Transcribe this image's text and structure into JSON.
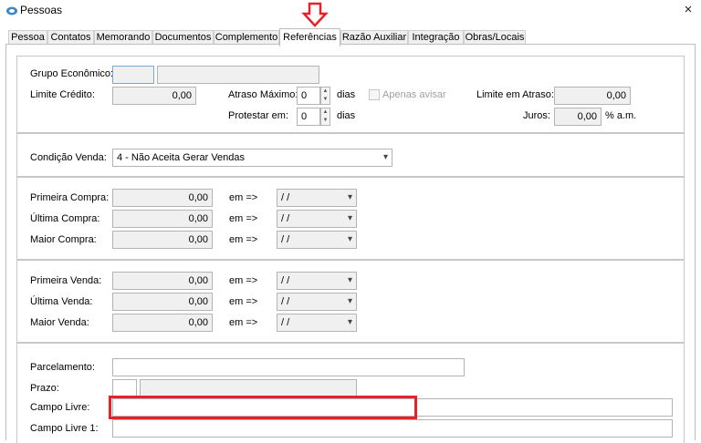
{
  "window": {
    "title": "Pessoas",
    "close_icon": "×"
  },
  "tabs": [
    {
      "label": "Pessoa"
    },
    {
      "label": "Contatos"
    },
    {
      "label": "Memorando"
    },
    {
      "label": "Documentos"
    },
    {
      "label": "Complemento"
    },
    {
      "label": "Referências"
    },
    {
      "label": "Razão Auxiliar"
    },
    {
      "label": "Integração"
    },
    {
      "label": "Obras/Locais"
    }
  ],
  "active_tab": "Referências",
  "credit": {
    "grupo_label": "Grupo Econômico:",
    "grupo_code": "",
    "grupo_name": "",
    "limite_label": "Limite Crédito:",
    "limite_value": "0,00",
    "atraso_label": "Atraso Máximo:",
    "atraso_value": "0",
    "dias1": "dias",
    "apenas_label": "Apenas avisar",
    "limite_atraso_label": "Limite em Atraso:",
    "limite_atraso_value": "0,00",
    "protestar_label": "Protestar em:",
    "protestar_value": "0",
    "dias2": "dias",
    "juros_label": "Juros:",
    "juros_value": "0,00",
    "juros_unit": "% a.m."
  },
  "condicao": {
    "label": "Condição Venda:",
    "value": "4 - Não Aceita Gerar Vendas"
  },
  "compras": [
    {
      "label": "Primeira Compra:",
      "value": "0,00",
      "em": "em =>",
      "date": "/ /"
    },
    {
      "label": "Última Compra:",
      "value": "0,00",
      "em": "em =>",
      "date": "/ /"
    },
    {
      "label": "Maior Compra:",
      "value": "0,00",
      "em": "em =>",
      "date": "/ /"
    }
  ],
  "vendas": [
    {
      "label": "Primeira Venda:",
      "value": "0,00",
      "em": "em =>",
      "date": "/ /"
    },
    {
      "label": "Última Venda:",
      "value": "0,00",
      "em": "em =>",
      "date": "/ /"
    },
    {
      "label": "Maior Venda:",
      "value": "0,00",
      "em": "em =>",
      "date": "/ /"
    }
  ],
  "extra": {
    "parcelamento_label": "Parcelamento:",
    "parcelamento_value": "",
    "prazo_label": "Prazo:",
    "prazo_code": "",
    "prazo_name": "",
    "campo_livre_label": "Campo Livre:",
    "campo_livre_value": "",
    "campo_livre1_label": "Campo Livre 1:",
    "campo_livre1_value": ""
  },
  "colors": {
    "highlight": "#e8202a"
  }
}
